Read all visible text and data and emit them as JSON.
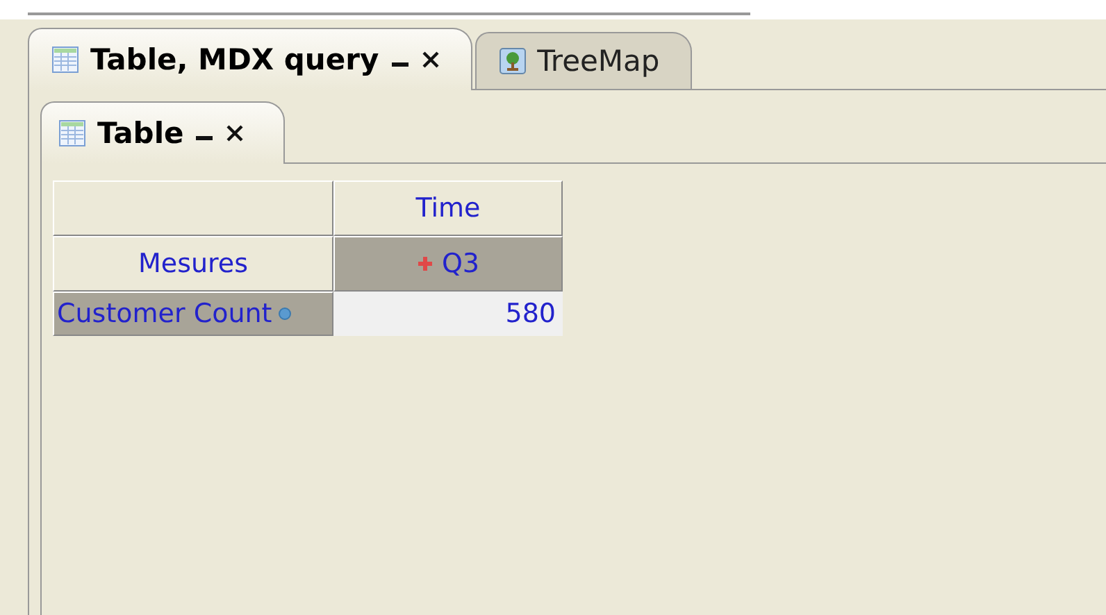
{
  "outer_tabs": [
    {
      "label": "Table, MDX query",
      "kind": "table",
      "selected": true,
      "closable": true
    },
    {
      "label": "TreeMap",
      "kind": "treemap",
      "selected": false,
      "closable": false
    }
  ],
  "inner_tabs": [
    {
      "label": "Table",
      "kind": "table",
      "selected": true,
      "closable": true
    }
  ],
  "table": {
    "column_header": "Time",
    "row_header": "Mesures",
    "member": {
      "label": "Q3",
      "expandable": true
    },
    "rows": [
      {
        "label": "Customer Count",
        "value": "580"
      }
    ]
  }
}
